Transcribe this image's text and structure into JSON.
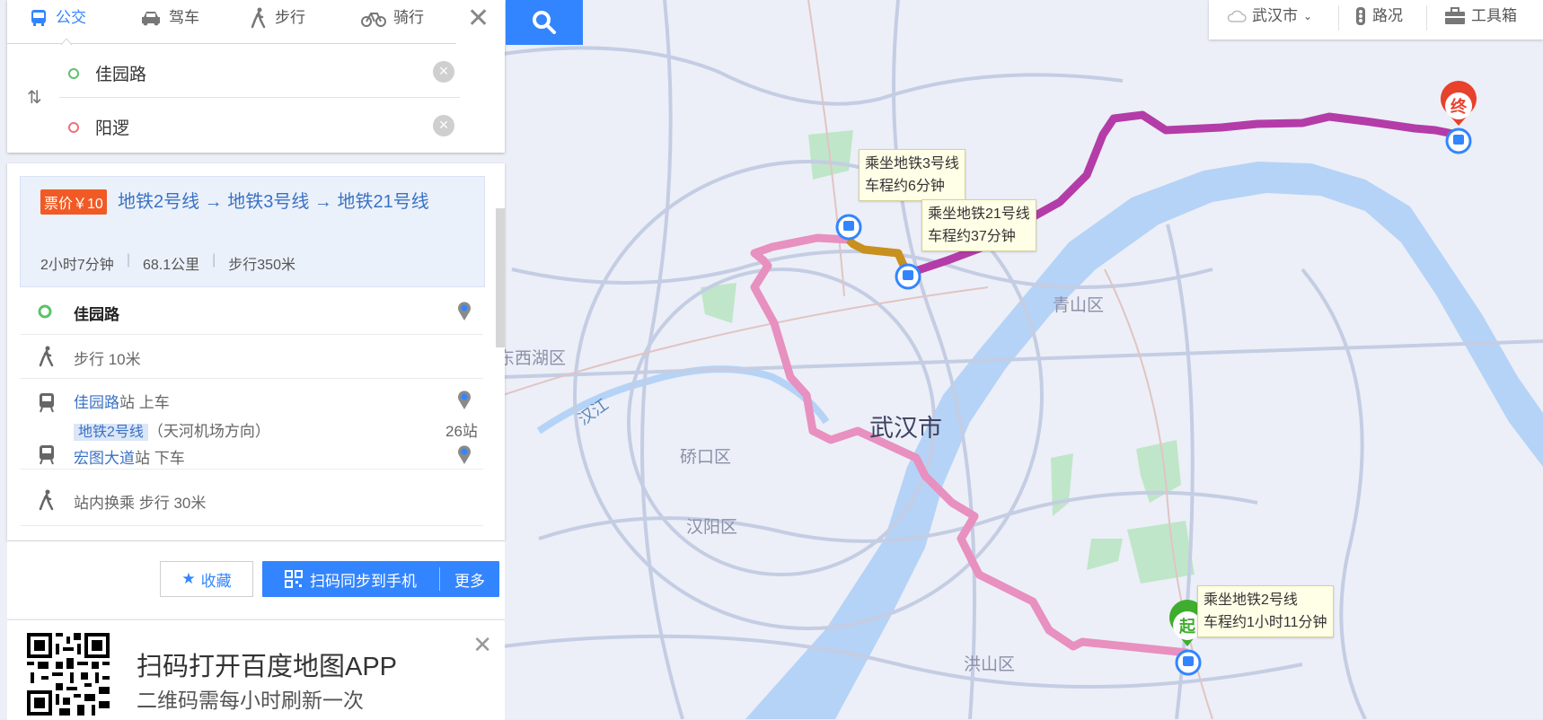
{
  "mode_tabs": [
    {
      "label": "公交",
      "icon": "bus-icon"
    },
    {
      "label": "驾车",
      "icon": "car-icon"
    },
    {
      "label": "步行",
      "icon": "walk-icon"
    },
    {
      "label": "骑行",
      "icon": "bike-icon"
    }
  ],
  "route_form": {
    "origin": "佳园路",
    "destination": "阳逻"
  },
  "route_summary": {
    "fare": "票价￥10",
    "lines": "地铁2号线 → 地铁3号线 → 地铁21号线",
    "duration": "2小时7分钟",
    "distance": "68.1公里",
    "walk": "步行350米"
  },
  "steps": {
    "start_name": "佳园路",
    "walk1": "步行  10米",
    "board_station": "佳园路",
    "board_suffix": "站  上车",
    "line_name": "地铁2号线",
    "direction": "（天河机场方向）",
    "stops": "26站",
    "alight_station": "宏图大道",
    "alight_suffix": "站  下车",
    "transfer": "站内换乘  步行  30米"
  },
  "actions": {
    "collect": "收藏",
    "scan_sync": "扫码同步到手机",
    "more": "更多"
  },
  "qr_promo": {
    "title": "扫码打开百度地图APP",
    "subtitle": "二维码需每小时刷新一次"
  },
  "top_right": {
    "city": "武汉市",
    "traffic": "路况",
    "toolbox": "工具箱"
  },
  "map": {
    "tips": [
      {
        "line1": "乘坐地铁3号线",
        "line2": "车程约6分钟"
      },
      {
        "line1": "乘坐地铁21号线",
        "line2": "车程约37分钟"
      },
      {
        "line1": "乘坐地铁2号线",
        "line2": "车程约1小时11分钟"
      }
    ],
    "start_marker": "起",
    "end_marker": "终",
    "city_label": "武汉市",
    "districts": [
      "青山区",
      "东西湖区",
      "硚口区",
      "汉阳区",
      "洪山区"
    ],
    "river_label": "汉江",
    "colors": {
      "line2": "#e890c0",
      "line3": "#c8901e",
      "line21": "#b43ca8",
      "river": "#b5d3f7",
      "accent": "#3385ff"
    }
  }
}
